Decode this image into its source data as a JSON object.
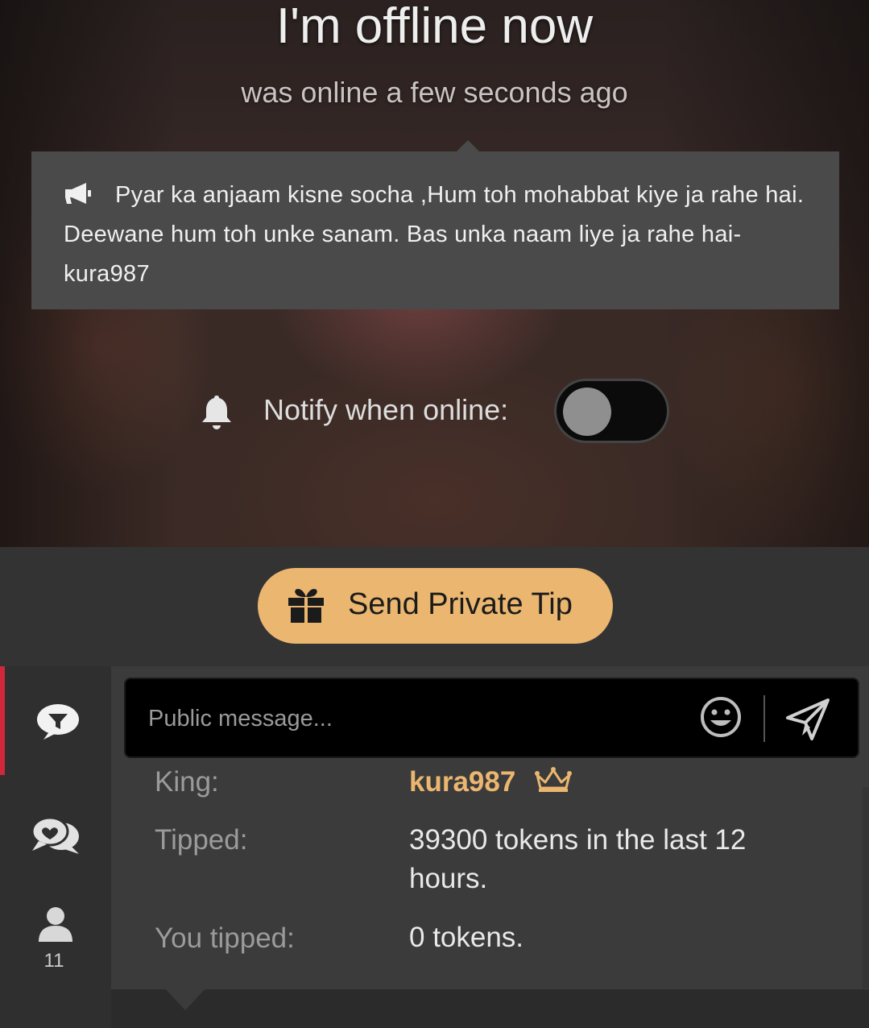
{
  "status": {
    "title": "I'm offline now",
    "subtitle": "was online a few seconds ago"
  },
  "announcement": {
    "icon": "megaphone-icon",
    "text": "Pyar ka anjaam kisne socha ,Hum toh mohabbat kiye ja rahe hai. Deewane hum toh unke sanam. Bas unka naam liye ja rahe hai-kura987"
  },
  "notify": {
    "label": "Notify when online:",
    "enabled": false
  },
  "tip": {
    "button_label": "Send Private Tip",
    "color": "#ebb66f"
  },
  "chat": {
    "placeholder": "Public message...",
    "accent_color": "#d0283a",
    "tabs": [
      {
        "icon": "public-chat-icon",
        "active": true
      },
      {
        "icon": "private-chat-icon",
        "active": false
      },
      {
        "icon": "users-icon",
        "count": "11",
        "active": false
      }
    ]
  },
  "king_info": {
    "king_label": "King:",
    "king_name": "kura987",
    "tipped_label": "Tipped:",
    "tipped_value": "39300 tokens in the last 12 hours.",
    "you_tipped_label": "You tipped:",
    "you_tipped_value": "0 tokens."
  }
}
